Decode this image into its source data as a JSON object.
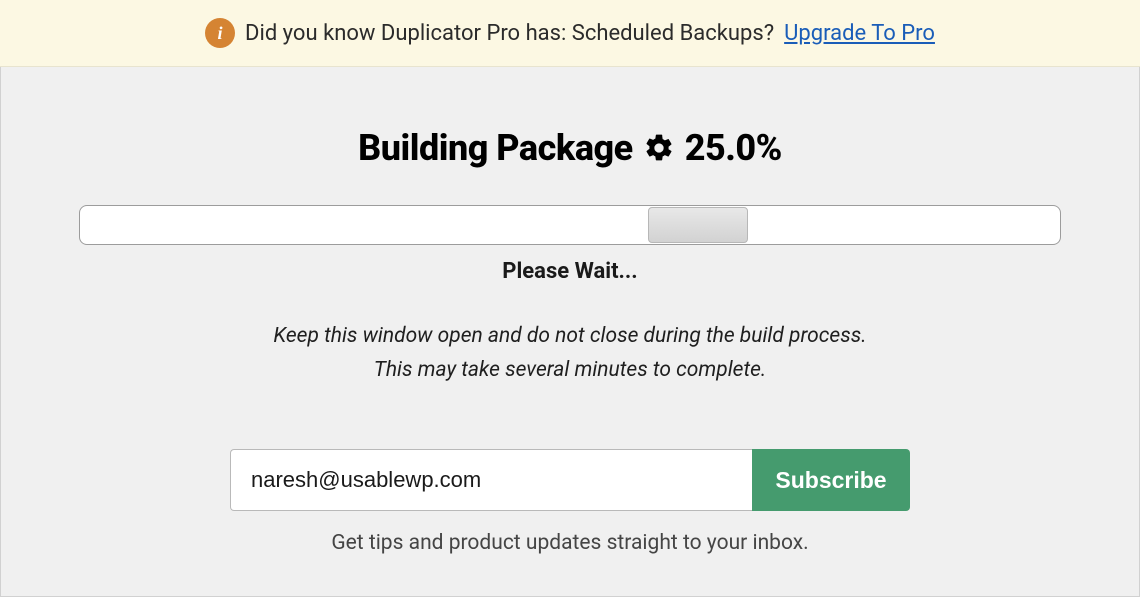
{
  "banner": {
    "text": "Did you know Duplicator Pro has: Scheduled Backups?",
    "upgrade_link": "Upgrade To Pro"
  },
  "build": {
    "title_prefix": "Building Package",
    "percent": "25.0%",
    "wait": "Please Wait...",
    "helper_line1": "Keep this window open and do not close during the build process.",
    "helper_line2": "This may take several minutes to complete."
  },
  "subscribe": {
    "email_value": "naresh@usablewp.com",
    "button": "Subscribe",
    "caption": "Get tips and product updates straight to your inbox."
  }
}
